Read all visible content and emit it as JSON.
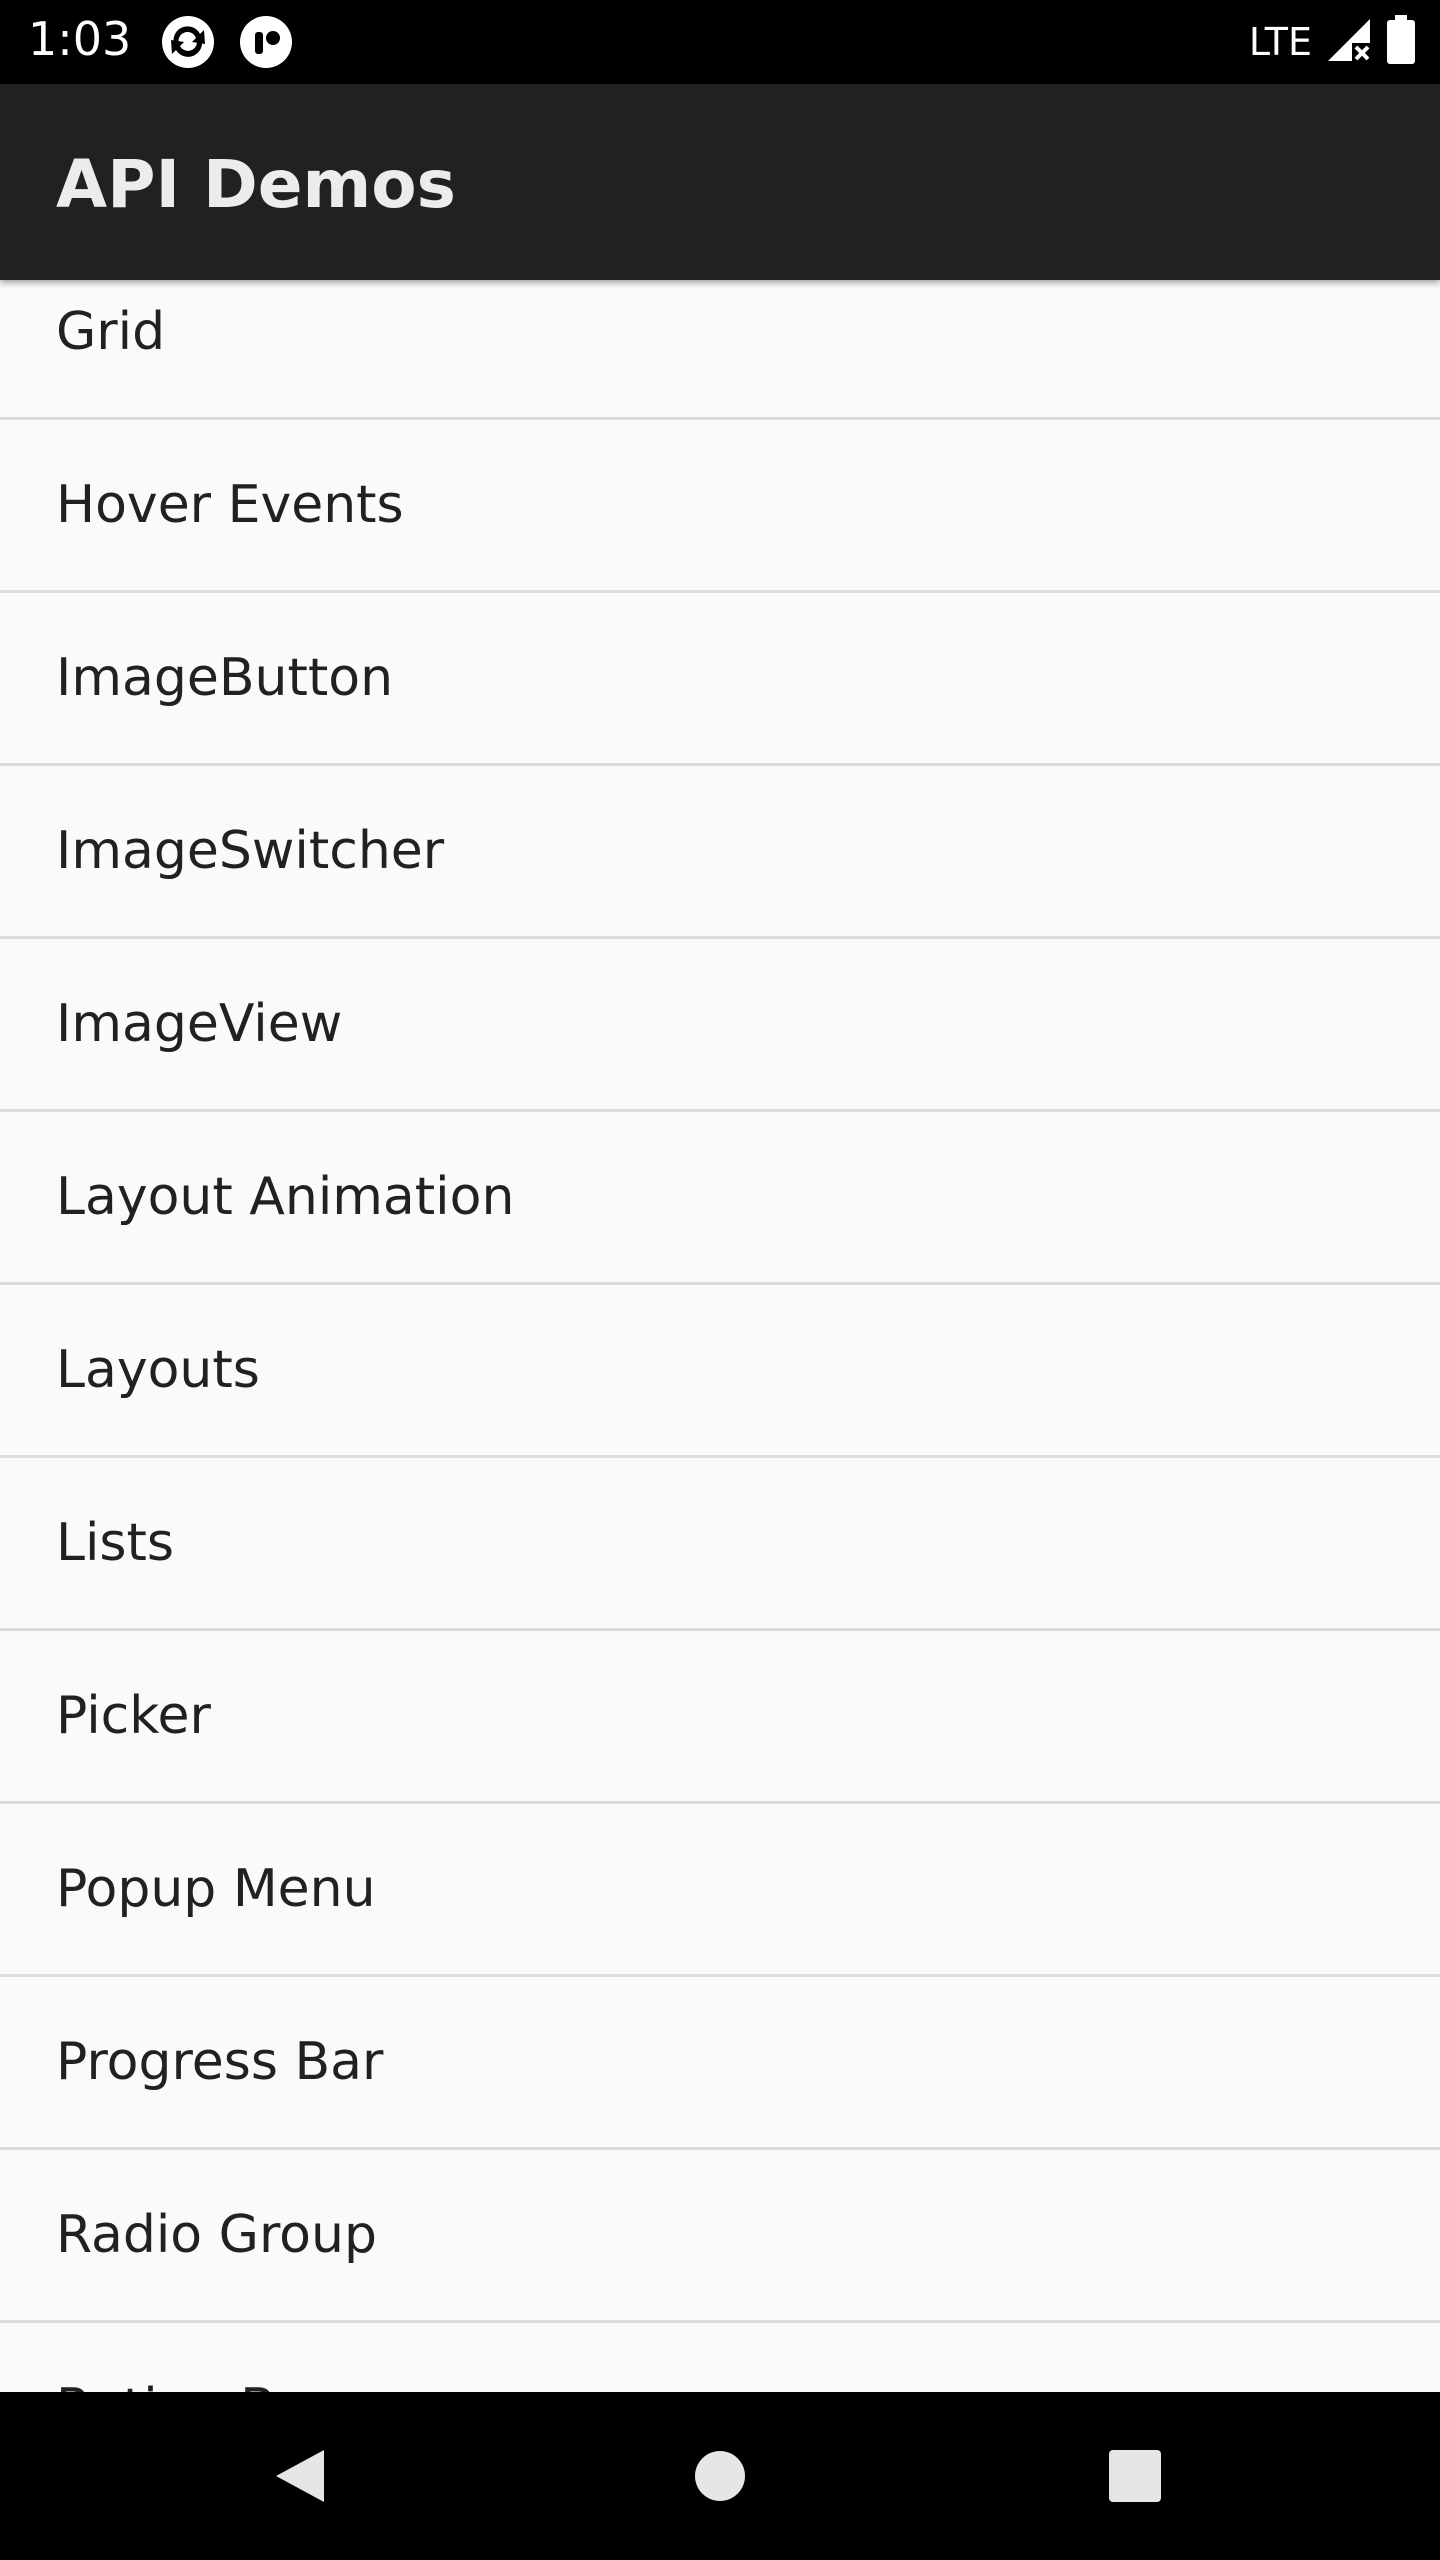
{
  "status_bar": {
    "time": "1:03",
    "network": "LTE",
    "icons": [
      "sync-notification-icon",
      "app-notification-icon",
      "signal-icon",
      "battery-icon"
    ]
  },
  "app_bar": {
    "title": "API Demos"
  },
  "list": {
    "items": [
      {
        "label": "Grid"
      },
      {
        "label": "Hover Events"
      },
      {
        "label": "ImageButton"
      },
      {
        "label": "ImageSwitcher"
      },
      {
        "label": "ImageView"
      },
      {
        "label": "Layout Animation"
      },
      {
        "label": "Layouts"
      },
      {
        "label": "Lists"
      },
      {
        "label": "Picker"
      },
      {
        "label": "Popup Menu"
      },
      {
        "label": "Progress Bar"
      },
      {
        "label": "Radio Group"
      },
      {
        "label": "Rating Bar"
      }
    ]
  },
  "nav_bar": {
    "buttons": [
      "back-icon",
      "home-icon",
      "recents-icon"
    ]
  },
  "colors": {
    "status_bar": "#000000",
    "app_bar": "#212121",
    "background": "#fafafa",
    "divider": "#dcdcdc",
    "text": "#212121"
  }
}
